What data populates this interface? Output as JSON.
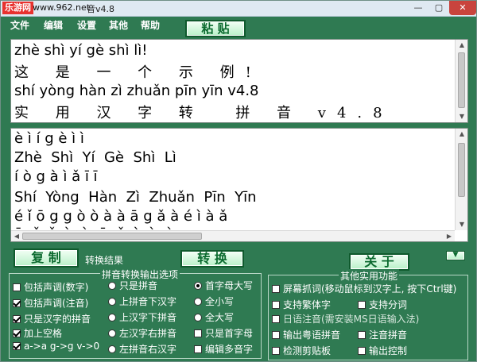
{
  "titlebar": {
    "watermark_logo": "乐游网",
    "watermark_site": "www.962.net",
    "title": "音v4.8"
  },
  "menu": [
    "文件",
    "编辑",
    "设置",
    "其他",
    "帮助"
  ],
  "buttons": {
    "paste": "粘 贴",
    "copy": "复 制",
    "result_label": "转换结果",
    "convert": "转 换",
    "close": "关 于",
    "mini": "▼"
  },
  "input_lines": [
    "zhè shì yí gè shì lì!",
    "这 是 一 个 示 例!",
    "shí yòng hàn zì zhuǎn pīn yīn v4.8",
    "实 用 汉 字 转  拼 音 v4.8"
  ],
  "output_lines": [
    "è ì í g è ì ì",
    "Zhè  Shì  Yí  Gè  Shì  Lì",
    "í ò g à ì ǎ ī ī",
    "Shí  Yòng  Hàn  Zì  Zhuǎn  Pīn  Yīn",
    "é ǐ ō g g ò ò à à ā g ǎ à é ì à ǎ",
    "ā  ǎ  ǐ  ò  à  ā  ǎ  ì  è  à"
  ],
  "options_group": {
    "title": "拼音转换输出选项",
    "col1": [
      {
        "label": "包括声调(数字)",
        "checked": false
      },
      {
        "label": "包括声调(注音)",
        "checked": true
      },
      {
        "label": "只是汉字的拼音",
        "checked": true
      },
      {
        "label": "加上空格",
        "checked": true
      },
      {
        "label": "a->a g->g v->0",
        "checked": true
      }
    ],
    "col2": [
      {
        "label": "只是拼音",
        "selected": false
      },
      {
        "label": "上拼音下汉字",
        "selected": false
      },
      {
        "label": "上汉字下拼音",
        "selected": false
      },
      {
        "label": "左汉字右拼音",
        "selected": false
      },
      {
        "label": "左拼音右汉字",
        "selected": false
      }
    ],
    "col3": [
      {
        "label": "首字母大写",
        "selected": true
      },
      {
        "label": "全小写",
        "selected": false
      },
      {
        "label": "全大写",
        "selected": false
      },
      {
        "label": "只是首字母",
        "checked": false
      },
      {
        "label": "编辑多音字",
        "checked": false
      }
    ]
  },
  "tools_group": {
    "title": "其他实用功能",
    "items": [
      {
        "label": "屏幕抓词(移动鼠标到汉字上, 按下Ctrl键)",
        "checked": false
      },
      {
        "label": "支持繁体字",
        "checked": false
      },
      {
        "label": "支持分词",
        "checked": false
      },
      {
        "label": "日语注音(需安装MS日语输入法)",
        "checked": false
      },
      {
        "label": "输出粤语拼音",
        "checked": false
      },
      {
        "label": "注音拼音",
        "checked": false
      },
      {
        "label": "检测剪贴板",
        "checked": false
      },
      {
        "label": "输出控制",
        "checked": false
      }
    ]
  }
}
